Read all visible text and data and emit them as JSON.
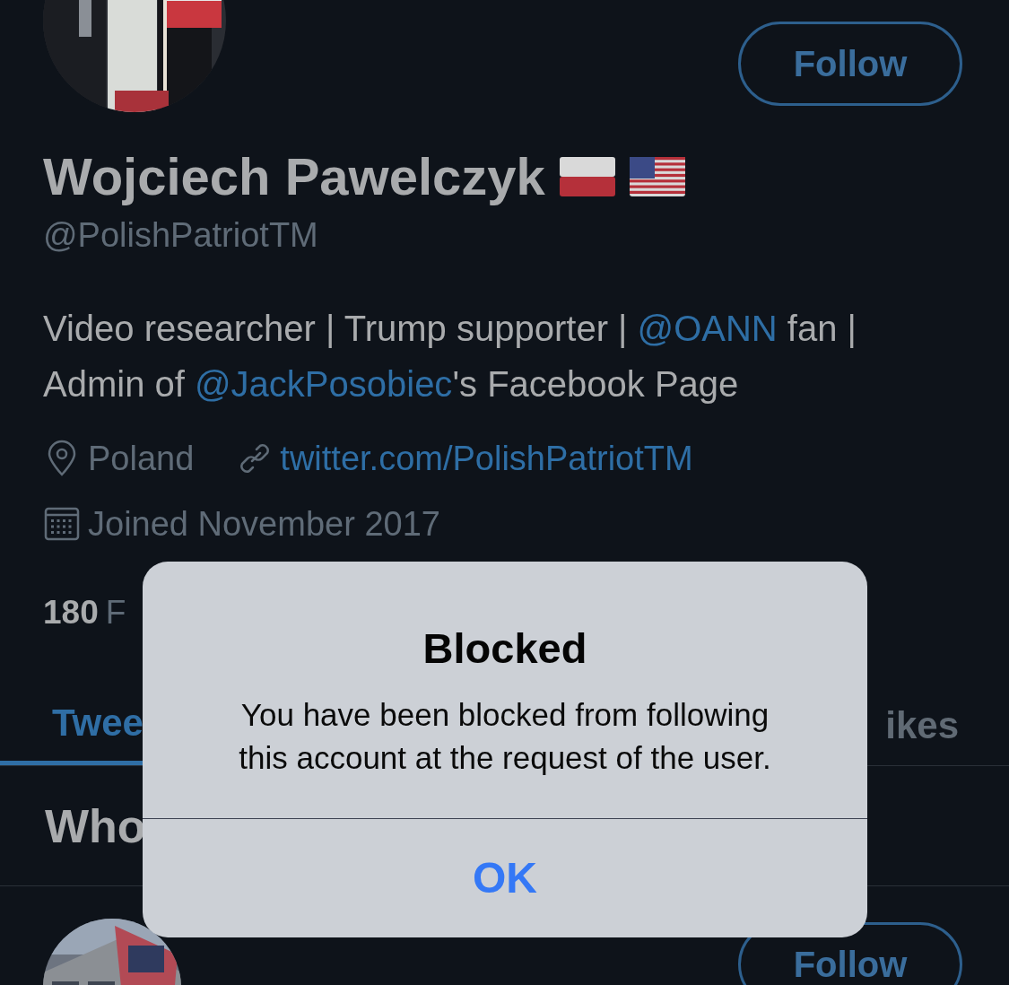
{
  "profile": {
    "follow_button": "Follow",
    "name": "Wojciech Pawelczyk",
    "handle": "@PolishPatriotTM",
    "bio": [
      {
        "kind": "text",
        "text": "Video researcher | Trump supporter | "
      },
      {
        "kind": "link",
        "text": "@OANN"
      },
      {
        "kind": "text",
        "text": " fan | Admin of "
      },
      {
        "kind": "link",
        "text": "@JackPosobiec"
      },
      {
        "kind": "text",
        "text": "'s Facebook Page"
      }
    ],
    "location": "Poland",
    "website": "twitter.com/PolishPatriotTM",
    "joined": "Joined November 2017",
    "following_count": "180",
    "following_label": "F"
  },
  "tabs": [
    {
      "label": "Twee",
      "selected": true
    },
    {
      "label": "ikes",
      "selected": false
    }
  ],
  "section_title": "Who",
  "suggestions": [
    {
      "follow_button": "Follow"
    }
  ],
  "dialog": {
    "title": "Blocked",
    "message": "You have been blocked from following this account at the request of the user.",
    "button": "OK"
  }
}
